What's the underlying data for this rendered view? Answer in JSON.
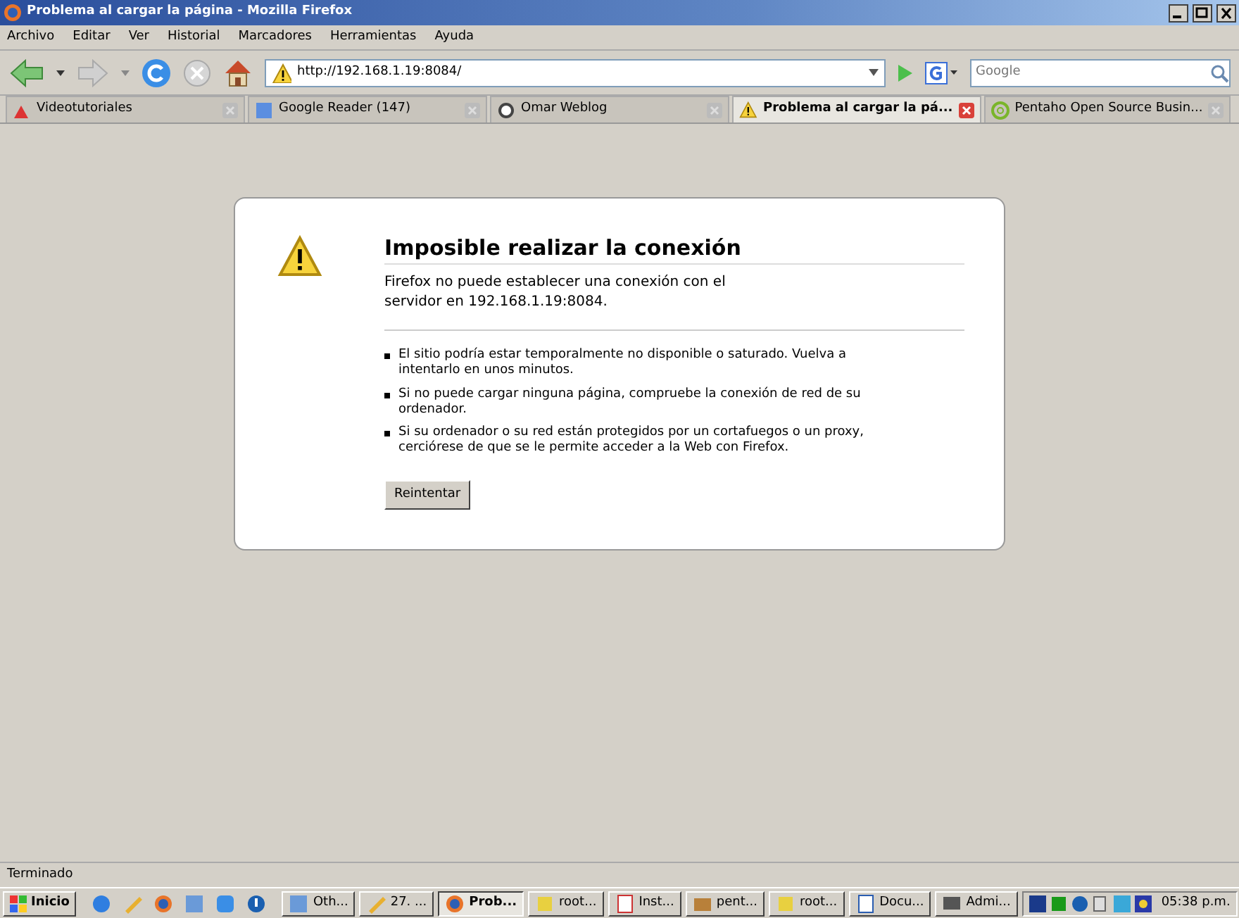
{
  "window": {
    "title": "Problema al cargar la página - Mozilla Firefox"
  },
  "menu": [
    "Archivo",
    "Editar",
    "Ver",
    "Historial",
    "Marcadores",
    "Herramientas",
    "Ayuda"
  ],
  "address": {
    "value": "http://192.168.1.19:8084/"
  },
  "search": {
    "placeholder": "Google"
  },
  "tabs": [
    {
      "label": "Videotutoriales",
      "selected": false
    },
    {
      "label": "Google Reader (147)",
      "selected": false
    },
    {
      "label": "Omar Weblog",
      "selected": false
    },
    {
      "label": "Problema al cargar la pá...",
      "selected": true
    },
    {
      "label": "Pentaho Open Source Busin...",
      "selected": false
    }
  ],
  "error": {
    "title": "Imposible realizar la conexión",
    "message": "Firefox no puede establecer una conexión con el servidor en 192.168.1.19:8084.",
    "bullets": [
      "El sitio podría estar temporalmente no disponible o saturado. Vuelva a intentarlo en unos minutos.",
      "Si no puede cargar ninguna página, compruebe la conexión de red de su ordenador.",
      "Si su ordenador o su red están protegidos por un cortafuegos o un proxy, cerciórese de que se le permite acceder a la Web con Firefox."
    ],
    "button": "Reintentar"
  },
  "status_bar": "Terminado",
  "taskbar": {
    "start": "Inicio",
    "tasks": [
      {
        "label": "Oth...",
        "selected": false
      },
      {
        "label": "27. ...",
        "selected": false
      },
      {
        "label": "Prob...",
        "selected": true
      },
      {
        "label": "root...",
        "selected": false
      },
      {
        "label": "Inst...",
        "selected": false
      },
      {
        "label": "pent...",
        "selected": false
      },
      {
        "label": "root...",
        "selected": false
      },
      {
        "label": "Docu...",
        "selected": false
      },
      {
        "label": "Admi...",
        "selected": false
      }
    ],
    "clock": "05:38 p.m."
  }
}
